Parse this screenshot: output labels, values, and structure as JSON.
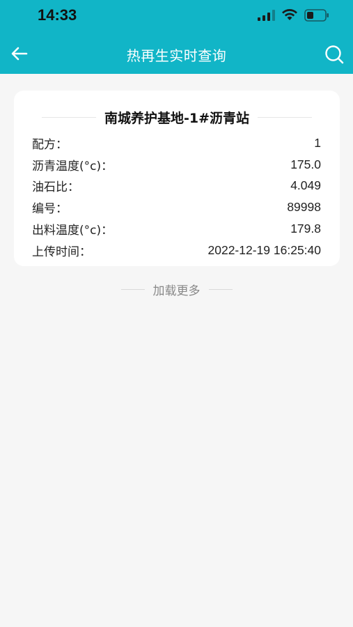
{
  "status_bar": {
    "time": "14:33",
    "icons": [
      "cellular-signal-icon",
      "wifi-icon",
      "battery-icon"
    ]
  },
  "nav": {
    "title": "热再生实时查询",
    "back_icon": "arrow-left-icon",
    "search_icon": "search-icon"
  },
  "colors": {
    "header_bg": "#11b5c7",
    "page_bg": "#f6f6f6",
    "card_bg": "#ffffff"
  },
  "record": {
    "title": "南城养护基地-1#沥青站",
    "fields": [
      {
        "label": "配方：",
        "value": "1"
      },
      {
        "label": "沥青温度(°c)：",
        "value": "175.0"
      },
      {
        "label": "油石比：",
        "value": "4.049"
      },
      {
        "label": "编号：",
        "value": "89998"
      },
      {
        "label": "出料温度(°c)：",
        "value": "179.8"
      },
      {
        "label": "上传时间：",
        "value": "2022-12-19 16:25:40"
      }
    ]
  },
  "load_more": {
    "label": "加载更多"
  }
}
